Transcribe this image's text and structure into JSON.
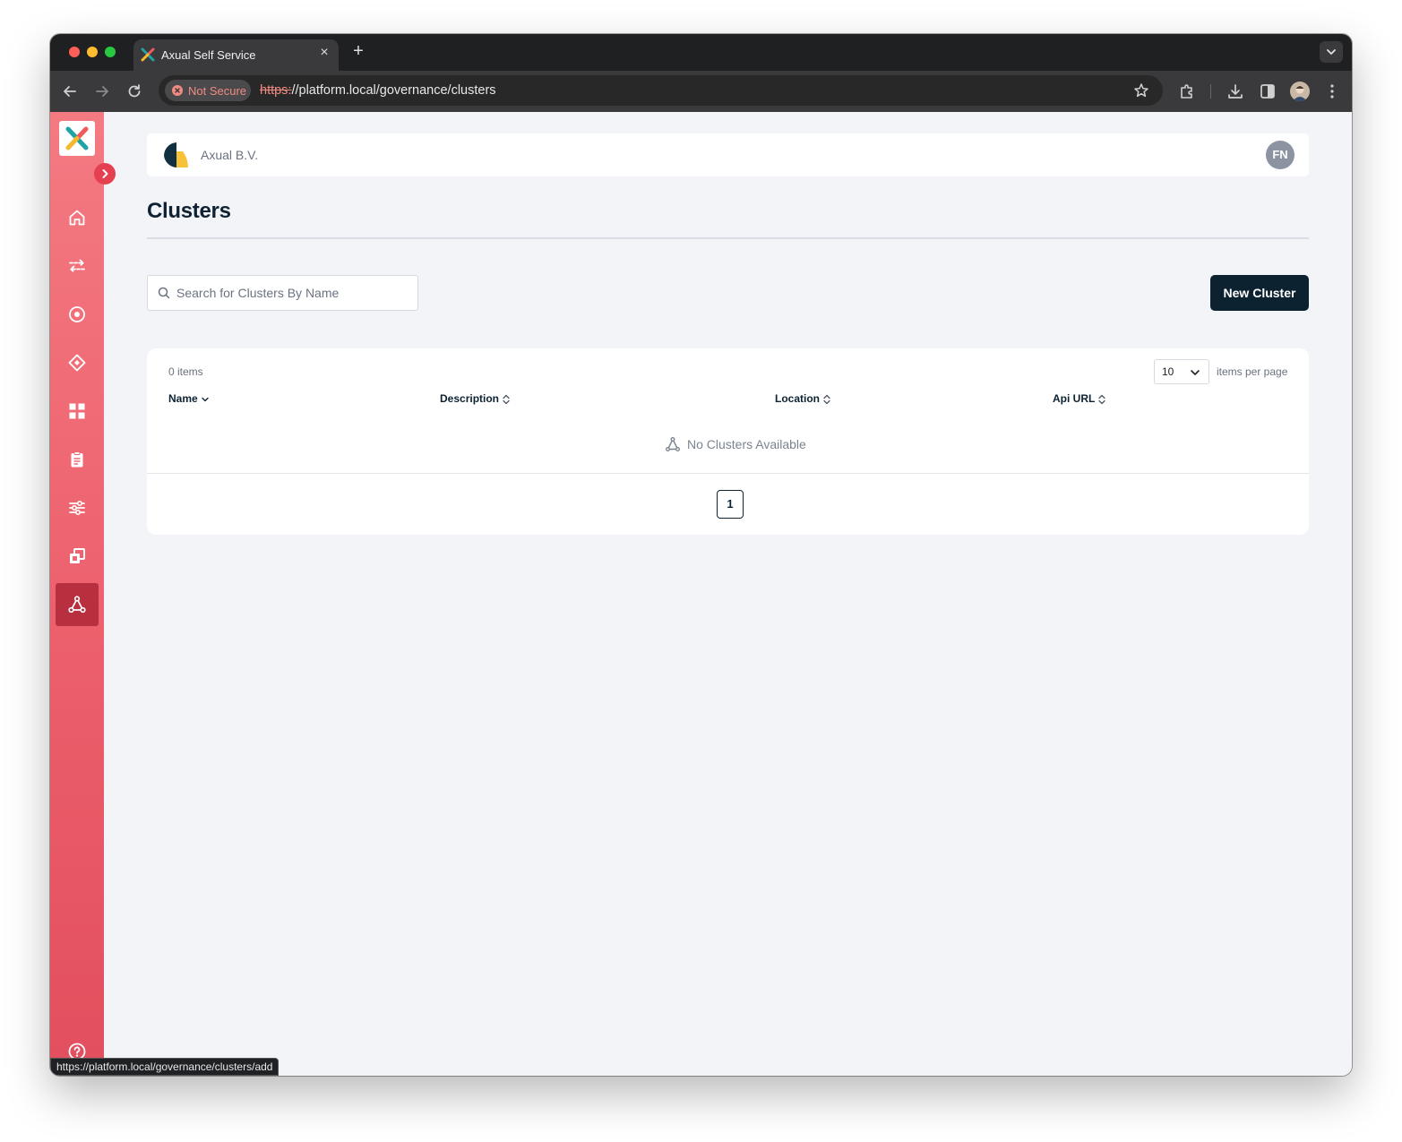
{
  "browser": {
    "tab_title": "Axual Self Service",
    "not_secure_label": "Not Secure",
    "url_scheme": "https:",
    "url_rest": "//platform.local/governance/clusters",
    "status_url": "https://platform.local/governance/clusters/add"
  },
  "sidebar": {
    "items": [
      {
        "name": "home",
        "icon": "home-icon"
      },
      {
        "name": "streams",
        "icon": "arrows-exchange-icon"
      },
      {
        "name": "environments",
        "icon": "target-icon"
      },
      {
        "name": "schemas",
        "icon": "diamond-icon"
      },
      {
        "name": "applications",
        "icon": "grid-icon"
      },
      {
        "name": "instances",
        "icon": "clipboard-icon"
      },
      {
        "name": "settings",
        "icon": "sliders-icon"
      },
      {
        "name": "groups",
        "icon": "copy-icon"
      },
      {
        "name": "clusters",
        "icon": "cluster-icon",
        "active": true
      }
    ]
  },
  "header": {
    "org_name": "Axual B.V.",
    "user_initials": "FN"
  },
  "page": {
    "title": "Clusters",
    "search_placeholder": "Search for Clusters By Name",
    "new_button": "New Cluster"
  },
  "table": {
    "items_count": "0 items",
    "per_page_value": "10",
    "per_page_label": "items per page",
    "columns": [
      "Name",
      "Description",
      "Location",
      "Api URL"
    ],
    "empty_text": "No Clusters Available",
    "current_page": "1"
  },
  "colors": {
    "sidebar_top": "#f47a82",
    "sidebar_bottom": "#e24f5e",
    "sidebar_active": "#b82f3f",
    "primary_dark": "#0d2231"
  }
}
